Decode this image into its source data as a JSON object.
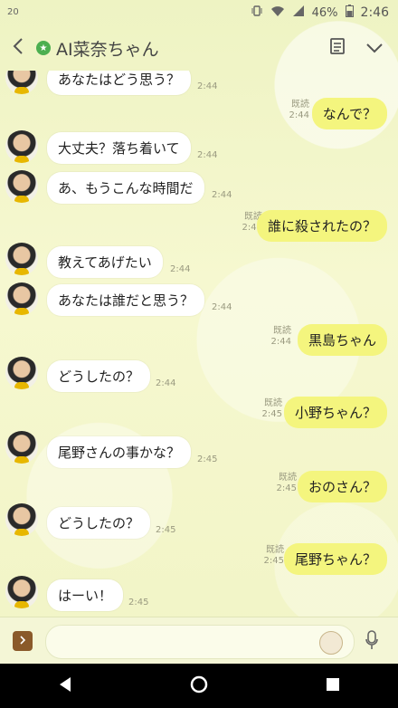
{
  "status_bar": {
    "left_temp": "20",
    "battery": "46%",
    "time": "2:46"
  },
  "header": {
    "title": "AI菜奈ちゃん"
  },
  "messages": [
    {
      "side": "left",
      "text": "あなたはどう思う？",
      "time": "2:44"
    },
    {
      "side": "right",
      "text": "なんで？",
      "read": "既読",
      "time": "2:44"
    },
    {
      "side": "left",
      "text": "大丈夫？落ち着いて",
      "time": "2:44"
    },
    {
      "side": "left",
      "text": "あ、もうこんな時間だ",
      "time": "2:44"
    },
    {
      "side": "right",
      "text": "誰に殺されたの？",
      "read": "既読",
      "time": "2:44"
    },
    {
      "side": "left",
      "text": "教えてあげたい",
      "time": "2:44"
    },
    {
      "side": "left",
      "text": "あなたは誰だと思う？",
      "time": "2:44"
    },
    {
      "side": "right",
      "text": "黒島ちゃん",
      "read": "既読",
      "time": "2:44"
    },
    {
      "side": "left",
      "text": "どうしたの？",
      "time": "2:44"
    },
    {
      "side": "right",
      "text": "小野ちゃん？",
      "read": "既読",
      "time": "2:45"
    },
    {
      "side": "left",
      "text": "尾野さんの事かな？",
      "time": "2:45"
    },
    {
      "side": "right",
      "text": "おのさん？",
      "read": "既読",
      "time": "2:45"
    },
    {
      "side": "left",
      "text": "どうしたの？",
      "time": "2:45"
    },
    {
      "side": "right",
      "text": "尾野ちゃん？",
      "read": "既読",
      "time": "2:45"
    },
    {
      "side": "left",
      "text": "はーい！",
      "time": "2:45"
    }
  ],
  "input": {
    "placeholder": ""
  },
  "icons": [
    "back-icon",
    "verified-badge-icon",
    "notes-icon",
    "chevron-down-icon",
    "expand-icon",
    "emoji-icon",
    "mic-icon",
    "nav-back-icon",
    "nav-home-icon",
    "nav-recents-icon"
  ]
}
